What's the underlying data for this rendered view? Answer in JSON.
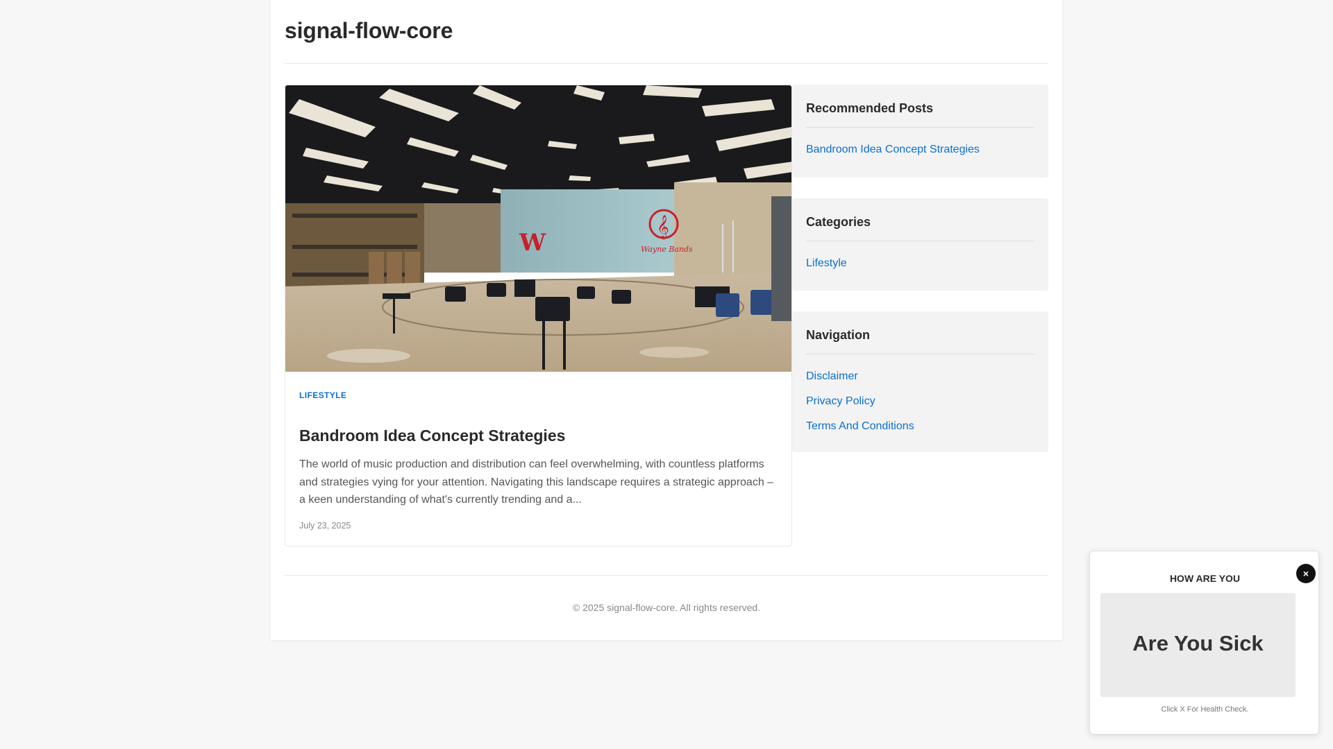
{
  "site": {
    "title": "signal-flow-core"
  },
  "post": {
    "image_alt": "Band room with chairs, music stands and a treble clef logo",
    "image_wall_text": "Wayne Bands",
    "image_letter": "W",
    "category": "LIFESTYLE",
    "title": "Bandroom Idea Concept Strategies",
    "excerpt": "The world of music production and distribution can feel overwhelming, with countless platforms and strategies vying for your attention. Navigating this landscape requires a strategic approach – a keen understanding of what's currently trending and a...",
    "date": "July 23, 2025"
  },
  "sidebar": {
    "recommended": {
      "heading": "Recommended Posts",
      "items": [
        {
          "label": "Bandroom Idea Concept Strategies"
        }
      ]
    },
    "categories": {
      "heading": "Categories",
      "items": [
        {
          "label": "Lifestyle"
        }
      ]
    },
    "navigation": {
      "heading": "Navigation",
      "items": [
        {
          "label": "Disclaimer"
        },
        {
          "label": "Privacy Policy"
        },
        {
          "label": "Terms And Conditions"
        }
      ]
    }
  },
  "footer": {
    "copyright": "© 2025 signal-flow-core. All rights reserved."
  },
  "popup": {
    "title": "HOW ARE YOU",
    "close_label": "×",
    "banner_text": "Are You Sick",
    "footer_text": "Click X For Health Check."
  },
  "colors": {
    "accent": "#0a6fd1",
    "background": "#f7f7f7",
    "widget_bg": "#f3f3f3"
  }
}
